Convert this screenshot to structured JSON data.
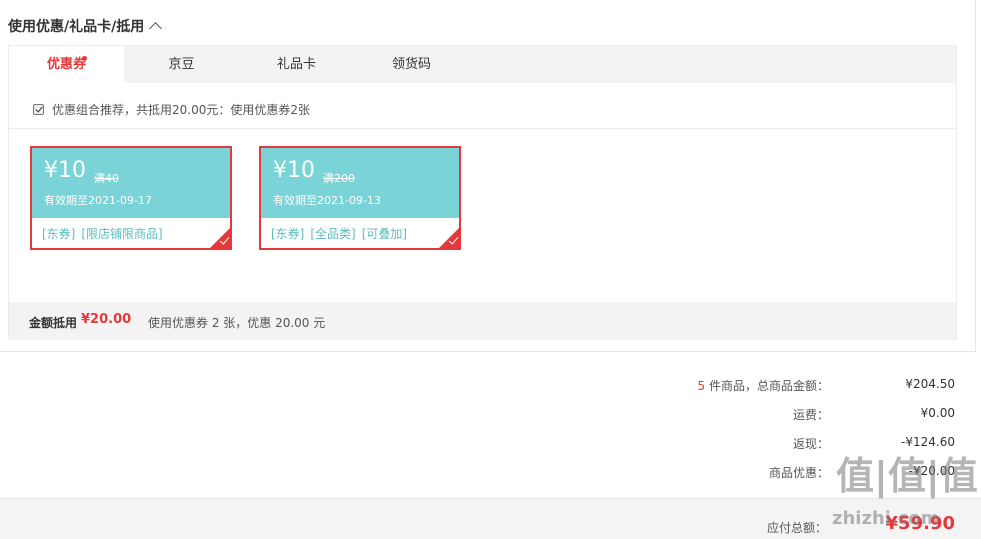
{
  "section": {
    "title": "使用优惠/礼品卡/抵用"
  },
  "tabs": [
    {
      "label": "优惠券"
    },
    {
      "label": "京豆"
    },
    {
      "label": "礼品卡"
    },
    {
      "label": "领货码"
    }
  ],
  "combo": {
    "text": "优惠组合推荐，共抵用20.00元：使用优惠券2张"
  },
  "coupons": [
    {
      "amount": "¥10",
      "condition": "满40",
      "expiry": "有效期至2021-09-17",
      "tags": [
        "[东券]",
        "[限店铺限商品]"
      ]
    },
    {
      "amount": "¥10",
      "condition": "满200",
      "expiry": "有效期至2021-09-13",
      "tags": [
        "[东券]",
        "[全品类]",
        "[可叠加]"
      ]
    }
  ],
  "summary": {
    "label": "金额抵用",
    "value": "¥20.00",
    "desc": "使用优惠券 2 张，优惠 20.00 元"
  },
  "totals": {
    "count": "5",
    "items_label": "件商品，总商品金额：",
    "items_amount": "¥204.50",
    "shipping_label": "运费：",
    "shipping_amount": "¥0.00",
    "cashback_label": "返现：",
    "cashback_amount": "-¥124.60",
    "discount_label": "商品优惠：",
    "discount_amount": "-¥20.00"
  },
  "pay": {
    "label": "应付总额：",
    "value": "¥59.90"
  },
  "watermark": {
    "big": "值|值|值",
    "small": "zhizhi.com"
  },
  "colors": {
    "accent": "#e4393c",
    "coupon_bg": "#7ad3d6",
    "coupon_tag": "#5cbcc1"
  },
  "icons": {
    "collapse": "chevron-up-icon",
    "checkbox": "checkbox-checked-icon",
    "selected": "check-corner-icon"
  }
}
